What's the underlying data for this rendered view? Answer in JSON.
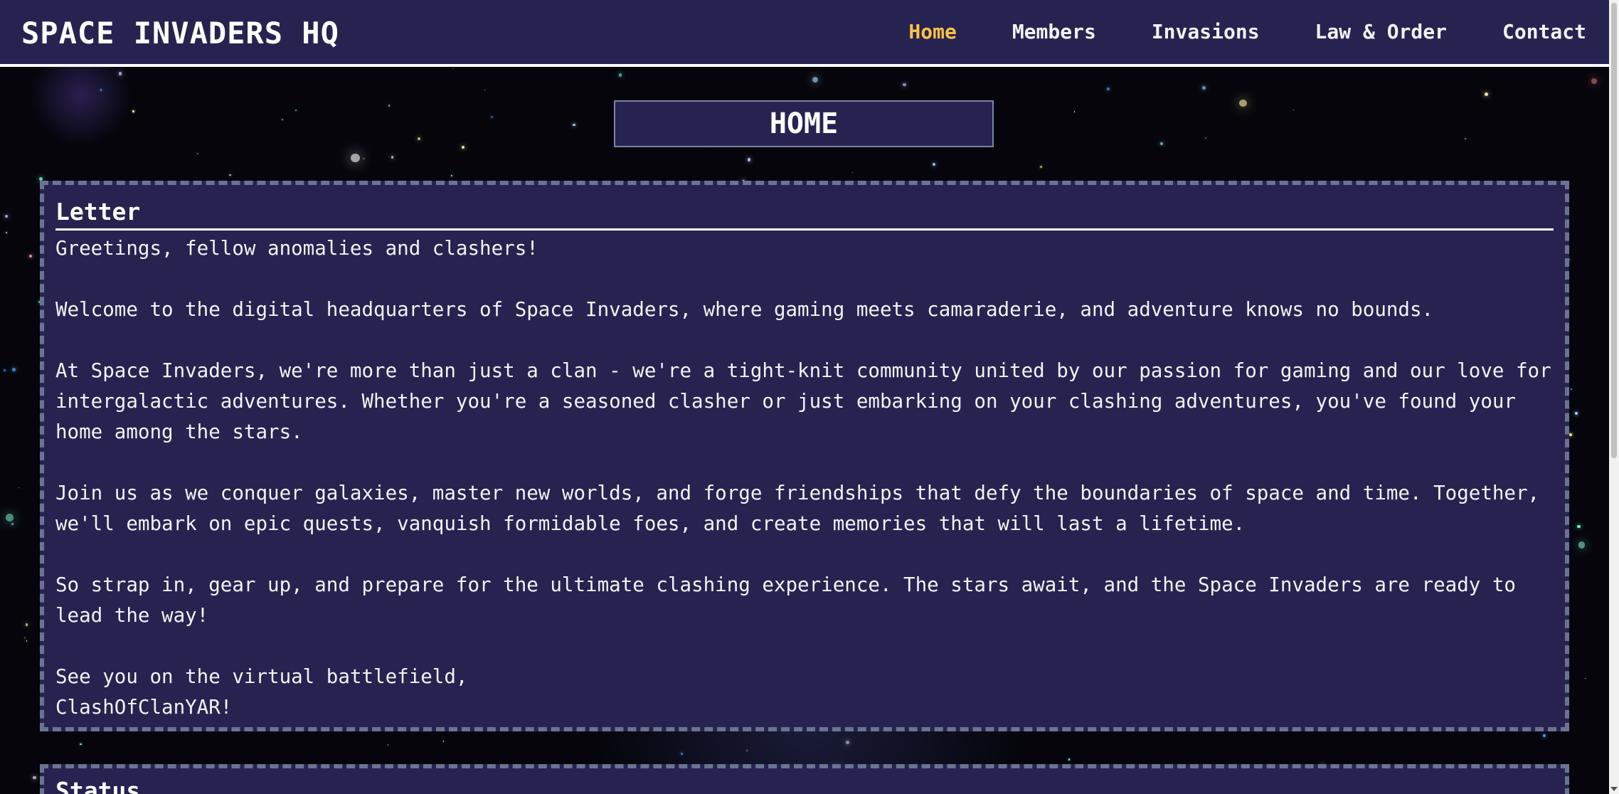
{
  "brand": "SPACE INVADERS HQ",
  "nav": {
    "items": [
      {
        "label": "Home",
        "active": true
      },
      {
        "label": "Members",
        "active": false
      },
      {
        "label": "Invasions",
        "active": false
      },
      {
        "label": "Law & Order",
        "active": false
      },
      {
        "label": "Contact",
        "active": false
      }
    ]
  },
  "page_title": "HOME",
  "letter": {
    "heading": "Letter",
    "paragraphs": [
      "Greetings, fellow anomalies and clashers!",
      "Welcome to the digital headquarters of Space Invaders, where gaming meets camaraderie, and adventure knows no bounds.",
      "At Space Invaders, we're more than just a clan - we're a tight-knit community united by our passion for gaming and our love for intergalactic adventures. Whether you're a seasoned clasher or just embarking on your clashing adventures, you've found your home among the stars.",
      "Join us as we conquer galaxies, master new worlds, and forge friendships that defy the boundaries of space and time. Together, we'll embark on epic quests, vanquish formidable foes, and create memories that will last a lifetime.",
      "So strap in, gear up, and prepare for the ultimate clashing experience. The stars await, and the Space Invaders are ready to lead the way!"
    ],
    "closing_line": "See you on the virtual battlefield,",
    "signature": "ClashOfClanYAR!"
  },
  "status": {
    "heading": "Status"
  },
  "colors": {
    "nav_background": "#262351",
    "active_link": "#f7c244",
    "panel_background": "#262351",
    "panel_border": "#6a7491",
    "page_background": "#05050b"
  }
}
